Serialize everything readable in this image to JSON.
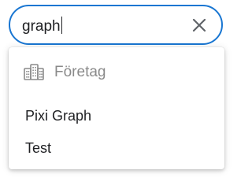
{
  "search": {
    "value": "graph",
    "clear_icon": "close-icon"
  },
  "dropdown": {
    "group": {
      "icon": "building-icon",
      "label": "Företag"
    },
    "options": [
      {
        "label": "Pixi Graph"
      },
      {
        "label": "Test"
      }
    ]
  },
  "colors": {
    "accent": "#1976d2",
    "text": "#202124",
    "muted": "#8a8a8a"
  }
}
